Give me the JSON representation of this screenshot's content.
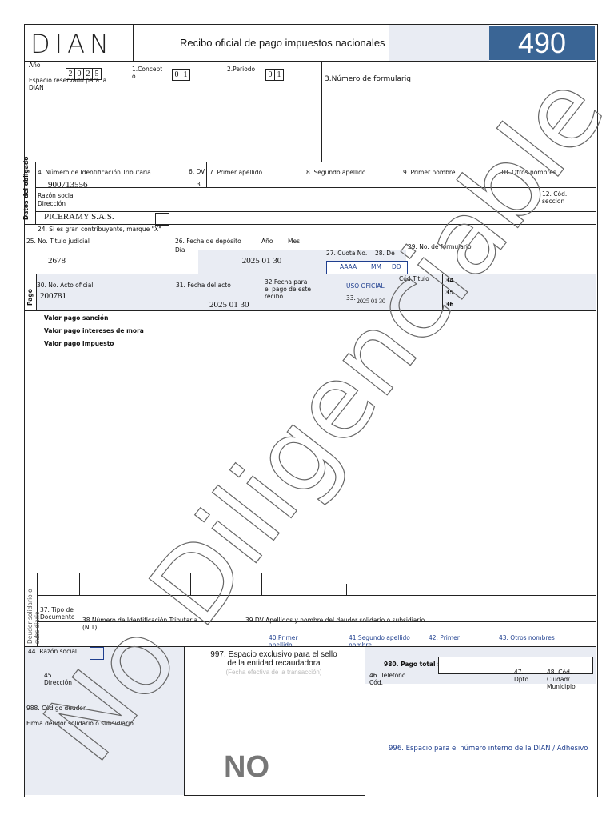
{
  "header": {
    "logo": "DIAN",
    "title": "Recibo oficial de pago impuestos nacionales",
    "form_number": "490"
  },
  "top": {
    "year_label": "Año",
    "year_digits": [
      "2",
      "0",
      "2",
      "5"
    ],
    "reserved": "Espacio reservado para la DIAN",
    "concept_label": "1.Concept o",
    "concept_digits": [
      "0",
      "1"
    ],
    "period_label": "2.Periodo",
    "period_digits": [
      "0",
      "1"
    ],
    "form_no_label": "3.Número de formulariq"
  },
  "obligado": {
    "side_label": "Datos del obligado",
    "nit_label": "4. Número de Identificación Tributaria",
    "nit_value": "900713556",
    "dv_label": "6. DV",
    "dv_value": "3",
    "l7": "7. Primer apellido",
    "l8": "8. Segundo apellido",
    "l9": "9. Primer nombre",
    "l10": "10. Otros nombres",
    "razon": "Razón social",
    "direccion": "Dirección",
    "l12": "12. Cód. seccion",
    "razon_value": "PICERAMY S.A.S."
  },
  "pago": {
    "l24": "24. Si es gran contribuyente, marque \"X\"",
    "l25": "25. No. Titulo judicial",
    "l26": "26. Fecha de depósito",
    "dia": "Día",
    "anio": "Año",
    "mes": "Mes",
    "v25": "2678",
    "fecha_dep": "2025  01  30",
    "l27": "27. Cuota No.",
    "l28": "28. De",
    "aaaa": "AAAA",
    "mm": "MM",
    "dd": "DD",
    "l29": "29. No. de formulario",
    "side": "Pago",
    "l30": "30. No. Acto oficial",
    "v30": "200781",
    "l31": "31. Fecha del acto",
    "v31": "2025  01  30",
    "l32": "32.Fecha para el pago de este recibo",
    "uso": "USO OFICIAL",
    "l33": "33.",
    "v33": "2025   01   30",
    "cod_titulo": "Cód.Titulo",
    "l34": "34",
    "l35": "35",
    "l36": "36"
  },
  "valores": [
    "Valor pago sanción",
    "Valor pago intereses de mora",
    "Valor pago impuesto"
  ],
  "deudor": {
    "side": "Deudor solidario o subsidiario",
    "l37": "37. Tipo de Documento",
    "l38": "38.Número de Identificación Tributaria (NIT)",
    "l39": "39.DV  Apellidos y nombre del deudor solidario o subsidiario",
    "l40": "40.Primer apellido",
    "l41": "41.Segundo apellido nombre",
    "l42": "42. Primer",
    "l43": "43. Otros nombres"
  },
  "bottom": {
    "l44": "44. Razón social",
    "l45": "45. Dirección",
    "l988": "988. Código deudor",
    "firma": "Firma deudor solidario o subsidiario",
    "l997": "997. Espacio exclusivo para el sello de la entidad recaudadora",
    "fecha_trans": "(Fecha efectiva de la transacción)",
    "no": "NO",
    "l980": "980. Pago total  $",
    "l46": "46. Telefono Cód.",
    "l47": "47. Dpto",
    "l48": "48. Cód. Ciudad/ Municipio",
    "l996": "996. Espacio para el número interno de la DIAN / Adhesivo"
  },
  "watermark": "No Diligenciable",
  "colors": {
    "brand": "#3a6595",
    "blue_text": "#1f3f8f",
    "shade": "#e9ecf3"
  }
}
